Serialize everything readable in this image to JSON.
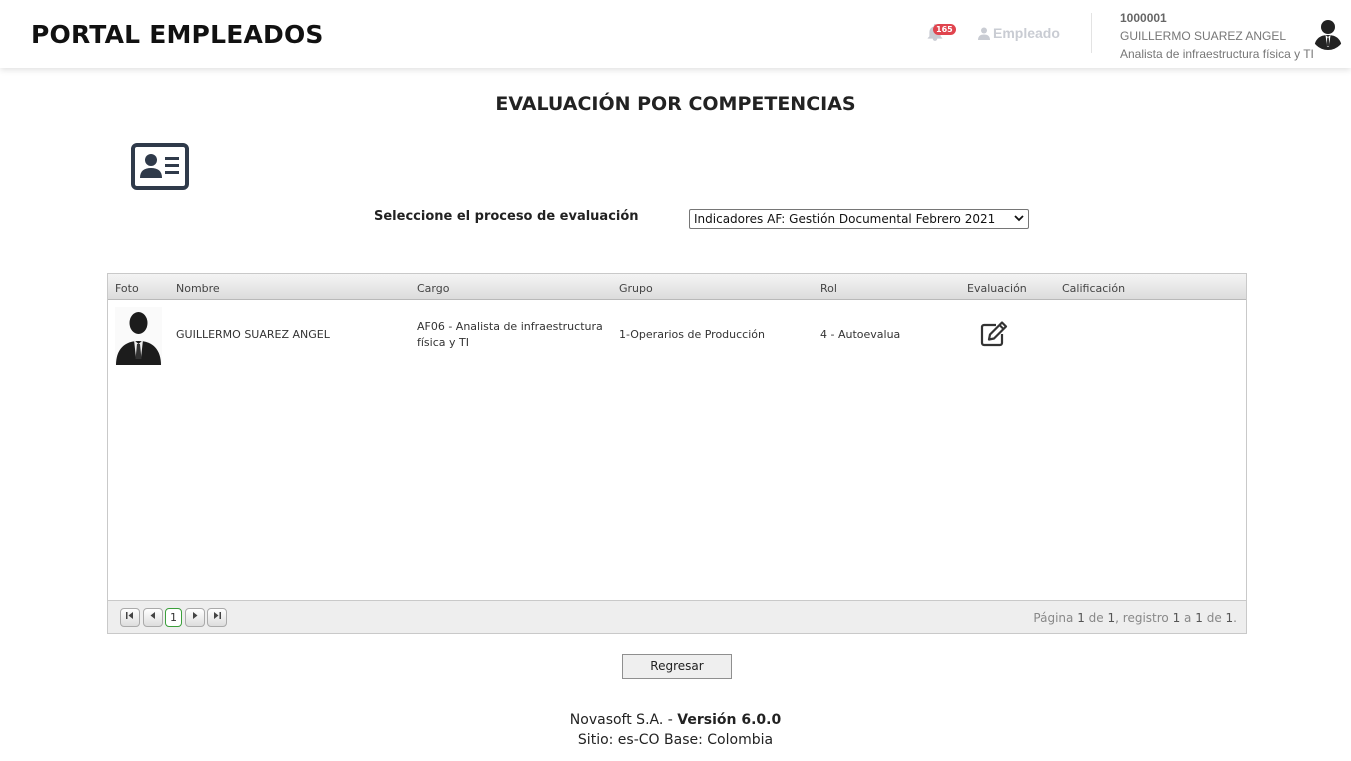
{
  "header": {
    "brand": "PORTAL EMPLEADOS",
    "notification_count": "165",
    "role_label": "Empleado",
    "user_id": "1000001",
    "user_name": "GUILLERMO SUAREZ ANGEL",
    "user_position": "Analista de infraestructura física y TI"
  },
  "main": {
    "title": "EVALUACIÓN POR COMPETENCIAS",
    "select_label": "Seleccione el proceso de evaluación",
    "selected_process": "Indicadores AF: Gestión Documental Febrero 2021"
  },
  "grid": {
    "columns": {
      "foto": "Foto",
      "nombre": "Nombre",
      "cargo": "Cargo",
      "grupo": "Grupo",
      "rol": "Rol",
      "evaluacion": "Evaluación",
      "calificacion": "Calificación"
    },
    "rows": [
      {
        "nombre": "GUILLERMO SUAREZ ANGEL",
        "cargo_line1": "AF06 - Analista de infraestructura",
        "cargo_line2": "física y TI",
        "grupo": "1-Operarios de Producción",
        "rol": "4 - Autoevalua",
        "calificacion": ""
      }
    ],
    "pager": {
      "current_page": "1",
      "info_prefix": "Página",
      "page": "1",
      "de1": "de",
      "total_pages": "1",
      "registro": ", registro",
      "from": "1",
      "a": "a",
      "to": "1",
      "de2": "de",
      "total": "1",
      "end": "."
    }
  },
  "actions": {
    "back_label": "Regresar"
  },
  "footer": {
    "company": "Novasoft S.A. -",
    "version": "Versión 6.0.0",
    "site": "Sitio: es-CO Base: Colombia"
  },
  "icons": {
    "notification": "bell-icon",
    "role": "user-icon",
    "card": "id-card-icon",
    "edit": "edit-icon",
    "pager_first": "first-page-icon",
    "pager_prev": "prev-page-icon",
    "pager_next": "next-page-icon",
    "pager_last": "last-page-icon"
  },
  "colors": {
    "badge": "#e0444e",
    "role_link": "#c9ccd3",
    "current_page_border": "#3b9f3b"
  }
}
